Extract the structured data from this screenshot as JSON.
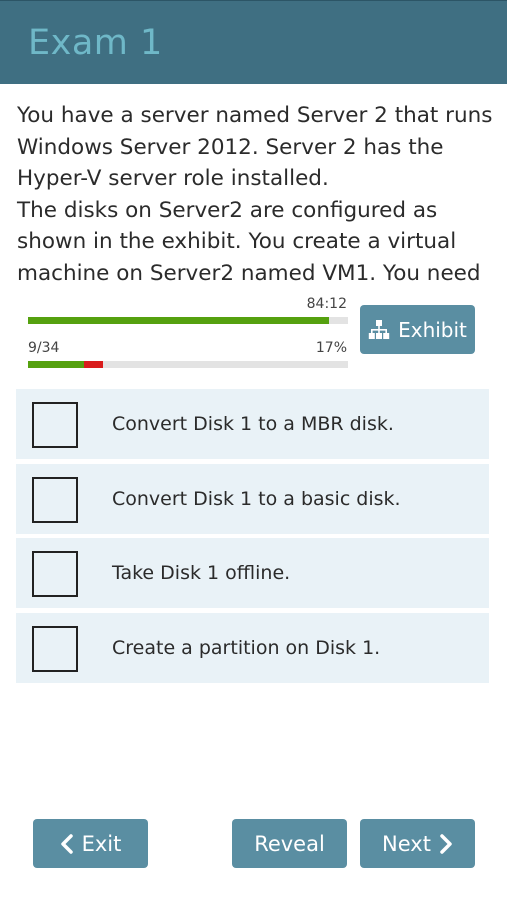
{
  "header": {
    "title": "Exam 1"
  },
  "question": {
    "text": "You have a server named Server 2 that runs\nWindows Server 2012. Server 2 has the\nHyper-V server role installed.\nThe disks on Server2 are configured as\nshown in the exhibit. You create a virtual\nmachine on Server2 named VM1. You need to"
  },
  "status": {
    "timer": "84:12",
    "time_fraction": 0.94,
    "progress_count": "9/34",
    "progress_percent": "17%",
    "progress_correct_fraction": 0.175,
    "progress_wrong_fraction": 0.06
  },
  "exhibit_button": {
    "label": "Exhibit",
    "icon": "sitemap-icon"
  },
  "options": [
    {
      "label": "Convert Disk 1 to a MBR disk.",
      "checked": false
    },
    {
      "label": "Convert Disk 1 to a basic disk.",
      "checked": false
    },
    {
      "label": "Take Disk 1 offline.",
      "checked": false
    },
    {
      "label": "Create a partition on Disk 1.",
      "checked": false
    }
  ],
  "footer": {
    "exit_label": "Exit",
    "reveal_label": "Reveal",
    "next_label": "Next"
  },
  "colors": {
    "header_bg": "#3f6f82",
    "header_title": "#6fb8c8",
    "button_bg": "#5a8ea2",
    "bar_green": "#55a10f",
    "bar_red": "#d91c1c",
    "option_bg": "#e9f2f7"
  }
}
